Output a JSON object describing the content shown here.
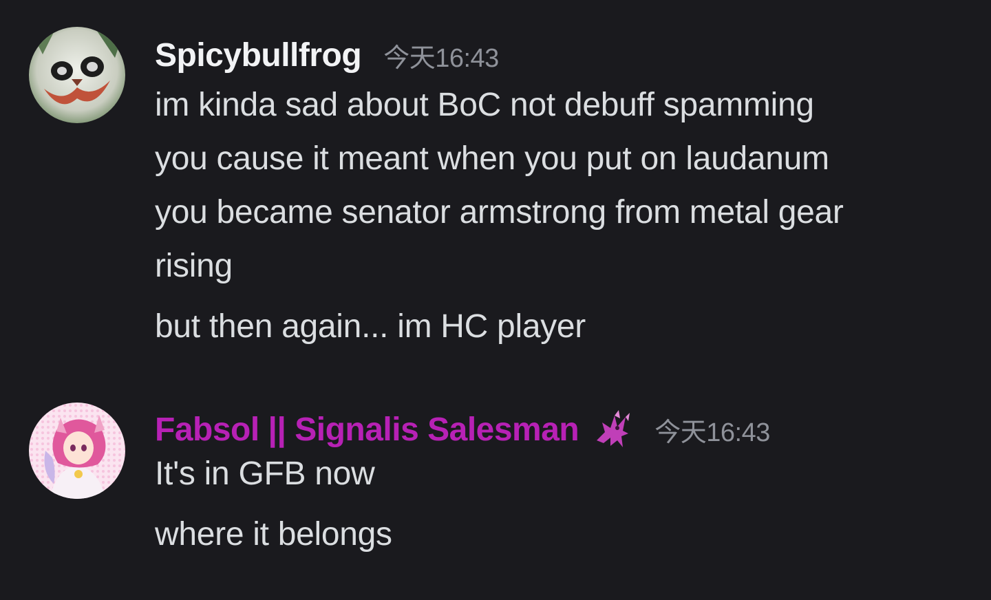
{
  "messages": [
    {
      "username": "Spicybullfrog",
      "timestamp": "今天16:43",
      "avatar_icon": "joker-cat-avatar",
      "lines": [
        "im kinda sad about BoC not debuff spamming",
        "you cause it meant when you put on laudanum",
        "you became senator armstrong from metal gear",
        "rising",
        "but then again... im HC player"
      ]
    },
    {
      "username": "Fabsol || Signalis Salesman",
      "username_color": "#b721b5",
      "role_icon": "pegasus-icon",
      "timestamp": "今天16:43",
      "avatar_icon": "anime-girl-avatar",
      "lines": [
        "It's in GFB now",
        "where it belongs"
      ]
    }
  ],
  "colors": {
    "background": "#1a1a1e",
    "text": "#dbdee1",
    "timestamp": "#8f929a",
    "role": "#b721b5"
  }
}
